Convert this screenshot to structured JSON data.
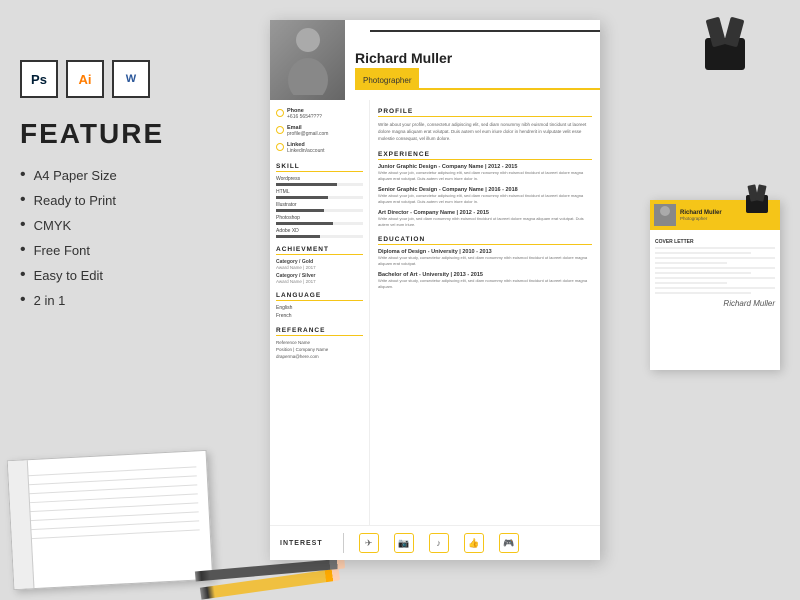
{
  "page": {
    "background_color": "#d8d8d8"
  },
  "software_icons": [
    {
      "id": "ps",
      "label": "Ps"
    },
    {
      "id": "ai",
      "label": "Ai"
    },
    {
      "id": "wd",
      "label": "W"
    }
  ],
  "feature_section": {
    "title": "FEATURE",
    "items": [
      "A4 Paper Size",
      "Ready to Print",
      "CMYK",
      "Free Font",
      "Easy to Edit",
      "2 in 1"
    ]
  },
  "resume": {
    "name": "Richard Muller",
    "title": "Photographer",
    "contact": {
      "phone_label": "Phone",
      "phone": "+616 5654????",
      "email_label": "Email",
      "email": "profile@gmail.com",
      "linkedin_label": "Linked",
      "linkedin": "Linkedin/account"
    },
    "sections": {
      "skill": "SKILL",
      "achievement": "ACHIEVMENT",
      "language": "LANGUAGE",
      "reference": "REFERANCE",
      "profile": "PROFILE",
      "experience": "EXPERIENCE",
      "education": "EDUCATION",
      "interest": "INTEREST"
    },
    "skills": [
      {
        "name": "Wordpress",
        "level": 70
      },
      {
        "name": "HTML",
        "level": 60
      },
      {
        "name": "Illustrator",
        "level": 55
      },
      {
        "name": "Photoshop",
        "level": 65
      },
      {
        "name": "Adobe XD",
        "level": 50
      }
    ],
    "achievements": [
      {
        "title": "Category / Gold",
        "year": "Award Name | 2017"
      },
      {
        "title": "Category / Silver",
        "year": "Award Name | 2017"
      }
    ],
    "languages": [
      "English",
      "French"
    ],
    "profile_text": "Write about your profile, consectetur adipiscing elit, sed diam nonummy nibh euismod tincidunt ut laoreet dolore magna aliquam erat volutpat. Duis autem vel eum iriure dolor in hendrerit in vulputate velit esse molestie consequat, vel illum dolore.",
    "experience": [
      {
        "title": "Junior Graphic Design - Company Name | 2012 - 2015",
        "desc": "Write about your job, consectetur adipiscing elit, sed diam nonummy nibh euismod tincidunt ut laoreet dolore magna aliquam erat volutpat. Duis autem vel eum iriure dolor in."
      },
      {
        "title": "Senior Graphic Design - Company Name | 2016 - 2018",
        "desc": "Write about your job, consectetur adipiscing elit, sed diam nonummy nibh euismod tincidunt ut laoreet dolore magna aliquam erat volutpat. Duis autem vel eum iriure dolor in."
      },
      {
        "title": "Art Director - Company Name | 2012 - 2015",
        "desc": "Write about your job, sed diam nonummy nibh euismod tincidunt ut laoreet dolore magna aliquam erat volutpat. Duis autem vel eum iriure."
      }
    ],
    "education": [
      {
        "title": "Diploma of Design - University | 2010 - 2013",
        "desc": "Write about your study, consectetur adipiscing elit, sed diam nonummy nibh euismod tincidunt ut laoreet dolore magna aliquam erat volutpat."
      },
      {
        "title": "Bachelor of Art - University | 2013 - 2015",
        "desc": "Write about your study, consectetur adipiscing elit, sed diam nonummy nibh euismod tincidunt ut laoreet dolore magna aliquam."
      }
    ],
    "reference": {
      "name": "Reference Name",
      "company": "Position | Company Name",
      "email": "draperma@here.com"
    }
  },
  "cover_letter": {
    "name": "Richard Muller",
    "subtitle": "Photographer",
    "section_label": "COVER LETTER",
    "signature": "Richard Muller"
  },
  "accent_color": "#f5c518"
}
